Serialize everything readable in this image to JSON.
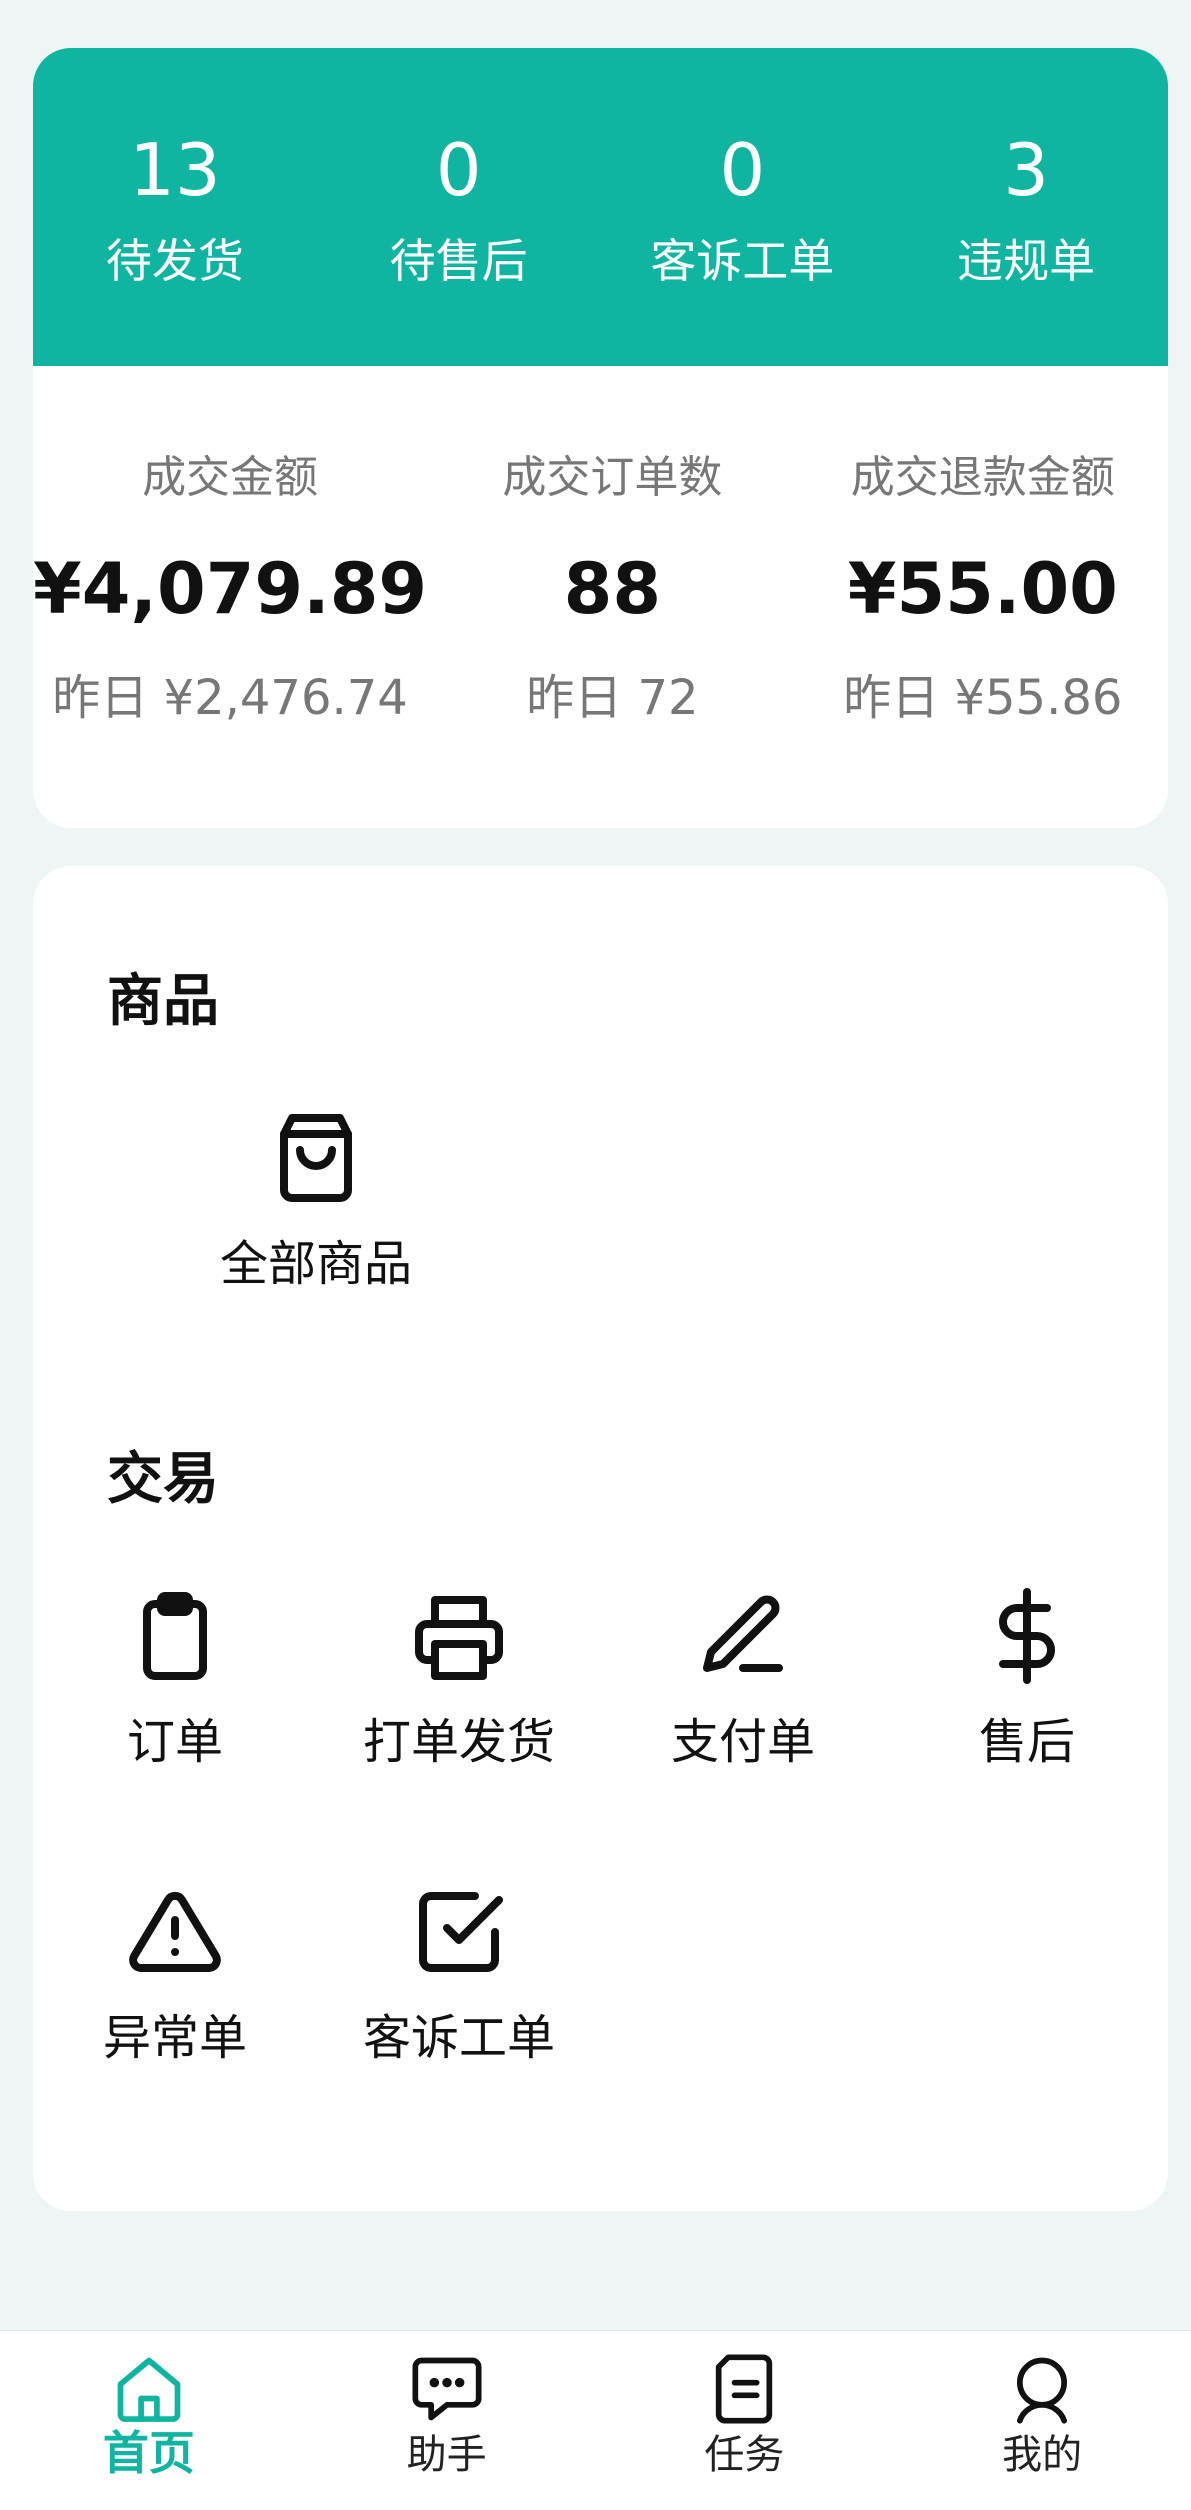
{
  "top_band": [
    {
      "value": "13",
      "label": "待发货"
    },
    {
      "value": "0",
      "label": "待售后"
    },
    {
      "value": "0",
      "label": "客诉工单"
    },
    {
      "value": "3",
      "label": "违规单"
    }
  ],
  "metrics": [
    {
      "label": "成交金额",
      "value": "¥4,079.89",
      "prev": "昨日 ¥2,476.74"
    },
    {
      "label": "成交订单数",
      "value": "88",
      "prev": "昨日 72"
    },
    {
      "label": "成交退款金额",
      "value": "¥55.00",
      "prev": "昨日 ¥55.86"
    }
  ],
  "sections": {
    "goods": {
      "title": "商品",
      "items": [
        {
          "label": "全部商品",
          "icon": "shopping-bag-icon"
        }
      ]
    },
    "trade": {
      "title": "交易",
      "items": [
        {
          "label": "订单",
          "icon": "clipboard-icon"
        },
        {
          "label": "打单发货",
          "icon": "printer-icon"
        },
        {
          "label": "支付单",
          "icon": "pen-icon"
        },
        {
          "label": "售后",
          "icon": "dollar-icon"
        },
        {
          "label": "异常单",
          "icon": "warning-icon"
        },
        {
          "label": "客诉工单",
          "icon": "checkbox-icon"
        }
      ]
    }
  },
  "nav": [
    {
      "label": "首页",
      "icon": "home-icon",
      "active": true
    },
    {
      "label": "助手",
      "icon": "chat-icon"
    },
    {
      "label": "任务",
      "icon": "document-icon"
    },
    {
      "label": "我的",
      "icon": "user-icon"
    }
  ],
  "colors": {
    "accent": "#0fb5a1",
    "background": "#eef5f4"
  }
}
